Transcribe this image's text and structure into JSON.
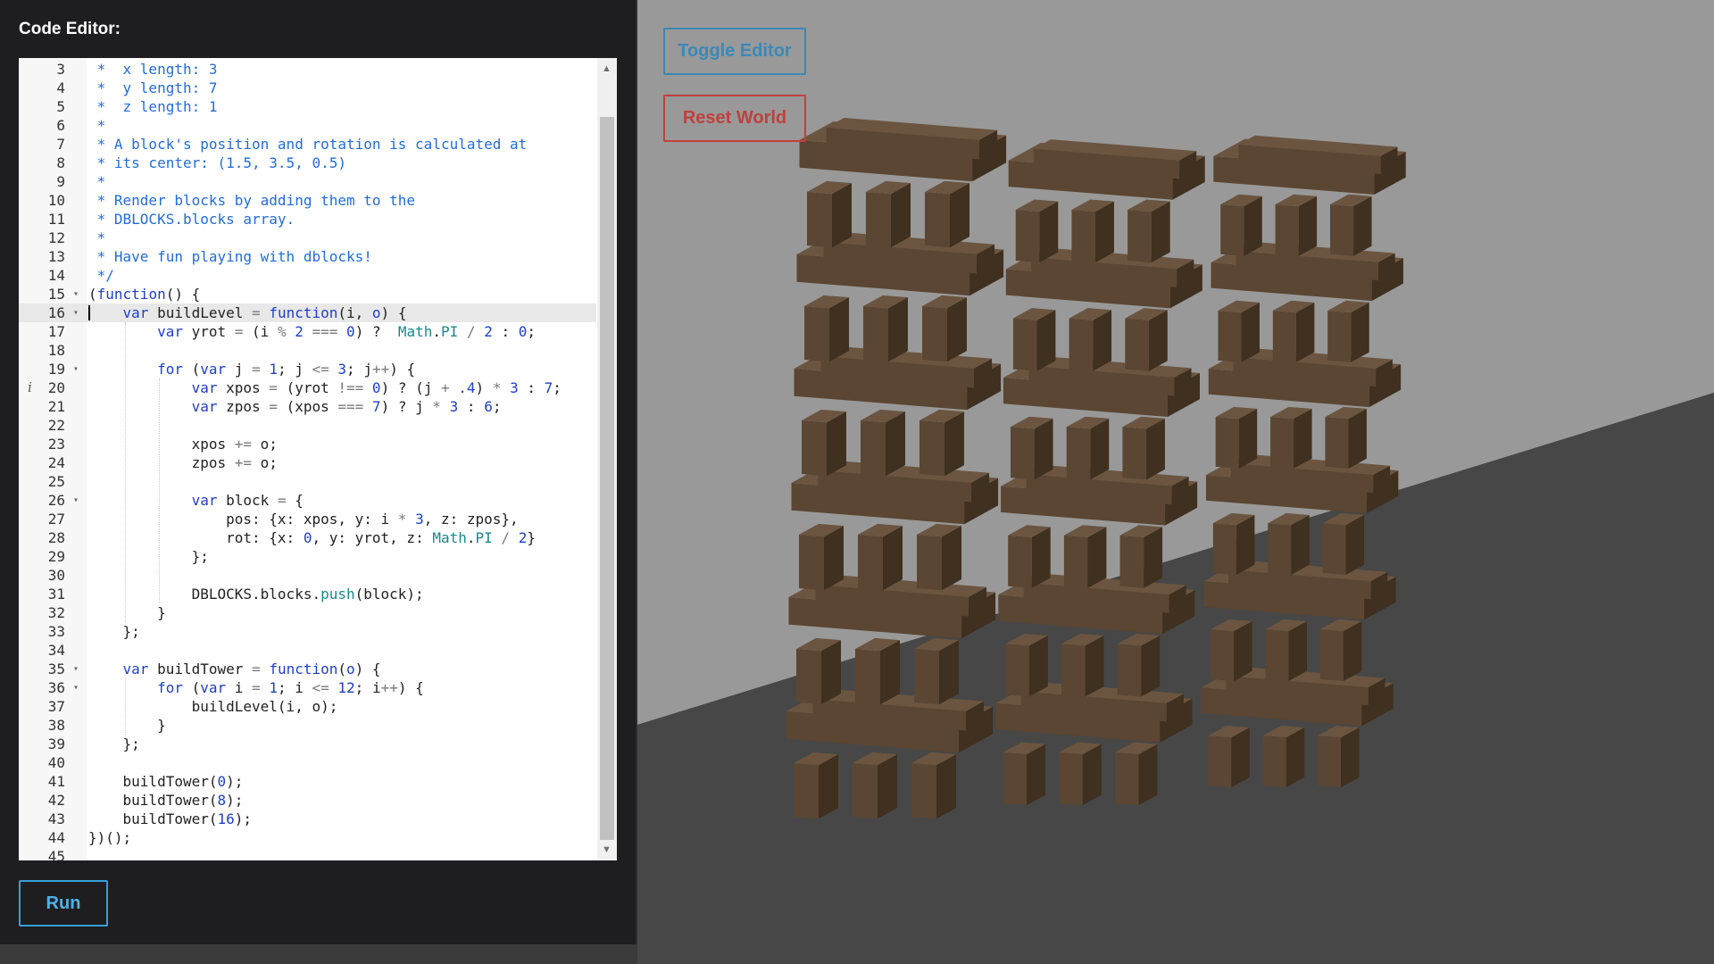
{
  "editor": {
    "title": "Code Editor:",
    "run_label": "Run",
    "lines": [
      {
        "n": "3",
        "fold": "",
        "tokens": [
          [
            "c",
            " *  x length: 3"
          ]
        ]
      },
      {
        "n": "4",
        "fold": "",
        "tokens": [
          [
            "c",
            " *  y length: 7"
          ]
        ]
      },
      {
        "n": "5",
        "fold": "",
        "tokens": [
          [
            "c",
            " *  z length: 1"
          ]
        ]
      },
      {
        "n": "6",
        "fold": "",
        "tokens": [
          [
            "c",
            " *"
          ]
        ]
      },
      {
        "n": "7",
        "fold": "",
        "tokens": [
          [
            "c",
            " * A block's position and rotation is calculated at"
          ]
        ]
      },
      {
        "n": "8",
        "fold": "",
        "tokens": [
          [
            "c",
            " * its center: (1.5, 3.5, 0.5)"
          ]
        ]
      },
      {
        "n": "9",
        "fold": "",
        "tokens": [
          [
            "c",
            " *"
          ]
        ]
      },
      {
        "n": "10",
        "fold": "",
        "tokens": [
          [
            "c",
            " * Render blocks by adding them to the"
          ]
        ]
      },
      {
        "n": "11",
        "fold": "",
        "tokens": [
          [
            "c",
            " * DBLOCKS.blocks array."
          ]
        ]
      },
      {
        "n": "12",
        "fold": "",
        "tokens": [
          [
            "c",
            " *"
          ]
        ]
      },
      {
        "n": "13",
        "fold": "",
        "tokens": [
          [
            "c",
            " * Have fun playing with dblocks!"
          ]
        ]
      },
      {
        "n": "14",
        "fold": "",
        "tokens": [
          [
            "c",
            " */"
          ]
        ]
      },
      {
        "n": "15",
        "fold": "▾",
        "tokens": [
          [
            "t",
            "("
          ],
          [
            "k",
            "function"
          ],
          [
            "t",
            "() {"
          ]
        ]
      },
      {
        "n": "16",
        "fold": "▾",
        "active": true,
        "tokens": [
          [
            "t",
            "    "
          ],
          [
            "k",
            "var"
          ],
          [
            "t",
            " buildLevel "
          ],
          [
            "o",
            "="
          ],
          [
            "t",
            " "
          ],
          [
            "k",
            "function"
          ],
          [
            "t",
            "(i, "
          ],
          [
            "m",
            "o"
          ],
          [
            "t",
            ") {"
          ]
        ]
      },
      {
        "n": "17",
        "fold": "",
        "tokens": [
          [
            "t",
            "        "
          ],
          [
            "k",
            "var"
          ],
          [
            "t",
            " yrot "
          ],
          [
            "o",
            "="
          ],
          [
            "t",
            " (i "
          ],
          [
            "o",
            "%"
          ],
          [
            "t",
            " "
          ],
          [
            "n",
            "2"
          ],
          [
            "t",
            " "
          ],
          [
            "o",
            "==="
          ],
          [
            "t",
            " "
          ],
          [
            "n",
            "0"
          ],
          [
            "t",
            ") ?  "
          ],
          [
            "p",
            "Math"
          ],
          [
            "t",
            "."
          ],
          [
            "p",
            "PI"
          ],
          [
            "t",
            " "
          ],
          [
            "o",
            "/"
          ],
          [
            "t",
            " "
          ],
          [
            "n",
            "2"
          ],
          [
            "t",
            " : "
          ],
          [
            "n",
            "0"
          ],
          [
            "t",
            ";"
          ]
        ]
      },
      {
        "n": "18",
        "fold": "",
        "tokens": [
          [
            "t",
            ""
          ]
        ]
      },
      {
        "n": "19",
        "fold": "▾",
        "tokens": [
          [
            "t",
            "        "
          ],
          [
            "k",
            "for"
          ],
          [
            "t",
            " ("
          ],
          [
            "k",
            "var"
          ],
          [
            "t",
            " j "
          ],
          [
            "o",
            "="
          ],
          [
            "t",
            " "
          ],
          [
            "n",
            "1"
          ],
          [
            "t",
            "; j "
          ],
          [
            "o",
            "<="
          ],
          [
            "t",
            " "
          ],
          [
            "n",
            "3"
          ],
          [
            "t",
            "; j"
          ],
          [
            "o",
            "++"
          ],
          [
            "t",
            ") {"
          ]
        ]
      },
      {
        "n": "20",
        "fold": "",
        "info": "i",
        "tokens": [
          [
            "t",
            "            "
          ],
          [
            "k",
            "var"
          ],
          [
            "t",
            " xpos "
          ],
          [
            "o",
            "="
          ],
          [
            "t",
            " (yrot "
          ],
          [
            "o",
            "!=="
          ],
          [
            "t",
            " "
          ],
          [
            "n",
            "0"
          ],
          [
            "t",
            ") ? (j "
          ],
          [
            "o",
            "+"
          ],
          [
            "t",
            " "
          ],
          [
            "n",
            ".4"
          ],
          [
            "t",
            ") "
          ],
          [
            "o",
            "*"
          ],
          [
            "t",
            " "
          ],
          [
            "n",
            "3"
          ],
          [
            "t",
            " : "
          ],
          [
            "n",
            "7"
          ],
          [
            "t",
            ";"
          ]
        ]
      },
      {
        "n": "21",
        "fold": "",
        "tokens": [
          [
            "t",
            "            "
          ],
          [
            "k",
            "var"
          ],
          [
            "t",
            " zpos "
          ],
          [
            "o",
            "="
          ],
          [
            "t",
            " (xpos "
          ],
          [
            "o",
            "==="
          ],
          [
            "t",
            " "
          ],
          [
            "n",
            "7"
          ],
          [
            "t",
            ") ? j "
          ],
          [
            "o",
            "*"
          ],
          [
            "t",
            " "
          ],
          [
            "n",
            "3"
          ],
          [
            "t",
            " : "
          ],
          [
            "n",
            "6"
          ],
          [
            "t",
            ";"
          ]
        ]
      },
      {
        "n": "22",
        "fold": "",
        "tokens": [
          [
            "t",
            ""
          ]
        ]
      },
      {
        "n": "23",
        "fold": "",
        "tokens": [
          [
            "t",
            "            xpos "
          ],
          [
            "o",
            "+="
          ],
          [
            "t",
            " o;"
          ]
        ]
      },
      {
        "n": "24",
        "fold": "",
        "tokens": [
          [
            "t",
            "            zpos "
          ],
          [
            "o",
            "+="
          ],
          [
            "t",
            " o;"
          ]
        ]
      },
      {
        "n": "25",
        "fold": "",
        "tokens": [
          [
            "t",
            ""
          ]
        ]
      },
      {
        "n": "26",
        "fold": "▾",
        "tokens": [
          [
            "t",
            "            "
          ],
          [
            "k",
            "var"
          ],
          [
            "t",
            " block "
          ],
          [
            "o",
            "="
          ],
          [
            "t",
            " {"
          ]
        ]
      },
      {
        "n": "27",
        "fold": "",
        "tokens": [
          [
            "t",
            "                pos: {x: xpos, y: i "
          ],
          [
            "o",
            "*"
          ],
          [
            "t",
            " "
          ],
          [
            "n",
            "3"
          ],
          [
            "t",
            ", z: zpos},"
          ]
        ]
      },
      {
        "n": "28",
        "fold": "",
        "tokens": [
          [
            "t",
            "                rot: {x: "
          ],
          [
            "n",
            "0"
          ],
          [
            "t",
            ", y: yrot, z: "
          ],
          [
            "p",
            "Math"
          ],
          [
            "t",
            "."
          ],
          [
            "p",
            "PI"
          ],
          [
            "t",
            " "
          ],
          [
            "o",
            "/"
          ],
          [
            "t",
            " "
          ],
          [
            "n",
            "2"
          ],
          [
            "t",
            "}"
          ]
        ]
      },
      {
        "n": "29",
        "fold": "",
        "tokens": [
          [
            "t",
            "            };"
          ]
        ]
      },
      {
        "n": "30",
        "fold": "",
        "tokens": [
          [
            "t",
            ""
          ]
        ]
      },
      {
        "n": "31",
        "fold": "",
        "tokens": [
          [
            "t",
            "            DBLOCKS.blocks."
          ],
          [
            "p",
            "push"
          ],
          [
            "t",
            "(block);"
          ]
        ]
      },
      {
        "n": "32",
        "fold": "",
        "tokens": [
          [
            "t",
            "        }"
          ]
        ]
      },
      {
        "n": "33",
        "fold": "",
        "tokens": [
          [
            "t",
            "    };"
          ]
        ]
      },
      {
        "n": "34",
        "fold": "",
        "tokens": [
          [
            "t",
            ""
          ]
        ]
      },
      {
        "n": "35",
        "fold": "▾",
        "tokens": [
          [
            "t",
            "    "
          ],
          [
            "k",
            "var"
          ],
          [
            "t",
            " buildTower "
          ],
          [
            "o",
            "="
          ],
          [
            "t",
            " "
          ],
          [
            "k",
            "function"
          ],
          [
            "t",
            "("
          ],
          [
            "m",
            "o"
          ],
          [
            "t",
            ") {"
          ]
        ]
      },
      {
        "n": "36",
        "fold": "▾",
        "tokens": [
          [
            "t",
            "        "
          ],
          [
            "k",
            "for"
          ],
          [
            "t",
            " ("
          ],
          [
            "k",
            "var"
          ],
          [
            "t",
            " i "
          ],
          [
            "o",
            "="
          ],
          [
            "t",
            " "
          ],
          [
            "n",
            "1"
          ],
          [
            "t",
            "; i "
          ],
          [
            "o",
            "<="
          ],
          [
            "t",
            " "
          ],
          [
            "n",
            "12"
          ],
          [
            "t",
            "; i"
          ],
          [
            "o",
            "++"
          ],
          [
            "t",
            ") {"
          ]
        ]
      },
      {
        "n": "37",
        "fold": "",
        "tokens": [
          [
            "t",
            "            buildLevel(i, o);"
          ]
        ]
      },
      {
        "n": "38",
        "fold": "",
        "tokens": [
          [
            "t",
            "        }"
          ]
        ]
      },
      {
        "n": "39",
        "fold": "",
        "tokens": [
          [
            "t",
            "    };"
          ]
        ]
      },
      {
        "n": "40",
        "fold": "",
        "tokens": [
          [
            "t",
            ""
          ]
        ]
      },
      {
        "n": "41",
        "fold": "",
        "tokens": [
          [
            "t",
            "    buildTower("
          ],
          [
            "n",
            "0"
          ],
          [
            "t",
            ");"
          ]
        ]
      },
      {
        "n": "42",
        "fold": "",
        "tokens": [
          [
            "t",
            "    buildTower("
          ],
          [
            "n",
            "8"
          ],
          [
            "t",
            ");"
          ]
        ]
      },
      {
        "n": "43",
        "fold": "",
        "tokens": [
          [
            "t",
            "    buildTower("
          ],
          [
            "n",
            "16"
          ],
          [
            "t",
            ");"
          ]
        ]
      },
      {
        "n": "44",
        "fold": "",
        "tokens": [
          [
            "t",
            "})();"
          ]
        ]
      },
      {
        "n": "45",
        "fold": "",
        "tokens": [
          [
            "t",
            ""
          ]
        ]
      }
    ]
  },
  "viewport": {
    "toggle_editor_label": "Toggle Editor",
    "reset_world_label": "Reset World",
    "tower_count": 3,
    "levels_per_tower": 12,
    "colors": {
      "wall": "#999999",
      "floor": "#474747",
      "block_front": "#5a4632",
      "block_side": "#3f3020",
      "block_top": "#6b5540",
      "accent_blue": "#3a89b8",
      "accent_red": "#c0403c"
    }
  }
}
